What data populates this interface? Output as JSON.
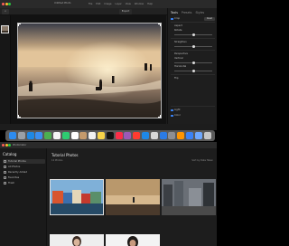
{
  "editor": {
    "title": "Untitled Photo",
    "menus": [
      "File",
      "Edit",
      "Image",
      "Layer",
      "View",
      "Window",
      "Help"
    ],
    "toolbar": {
      "back_label": "<",
      "export_label": "Export"
    },
    "panel": {
      "tabs": [
        "Tools",
        "Presets",
        "Styles"
      ],
      "active_tab": "Tools",
      "rows": [
        {
          "label": "Crop",
          "checked": true,
          "button": "Reset"
        },
        {
          "label": "Aspect",
          "checked": false,
          "button": ""
        },
        {
          "label": "Rotate",
          "checked": false,
          "button": ""
        },
        {
          "label": "Straighten",
          "checked": false,
          "button": ""
        },
        {
          "label": "Perspective",
          "checked": false,
          "button": ""
        },
        {
          "label": "Vertical",
          "checked": false,
          "button": ""
        },
        {
          "label": "Horizontal",
          "checked": false,
          "button": ""
        },
        {
          "label": "Flip",
          "checked": false,
          "button": ""
        },
        {
          "label": "Light",
          "checked": true,
          "button": ""
        },
        {
          "label": "Color",
          "checked": true,
          "button": ""
        }
      ]
    }
  },
  "dock": {
    "apps": [
      {
        "name": "finder",
        "color": "#2d8cf0"
      },
      {
        "name": "launchpad",
        "color": "#9aa0a6"
      },
      {
        "name": "safari",
        "color": "#1e88e5"
      },
      {
        "name": "mail",
        "color": "#3b8ef0"
      },
      {
        "name": "maps",
        "color": "#4caf50"
      },
      {
        "name": "photos",
        "color": "#f5f5f5"
      },
      {
        "name": "facetime",
        "color": "#2ecc71"
      },
      {
        "name": "calendar",
        "color": "#ffffff"
      },
      {
        "name": "contacts",
        "color": "#c49a6c"
      },
      {
        "name": "reminders",
        "color": "#f0f0f0"
      },
      {
        "name": "notes",
        "color": "#f7d34a"
      },
      {
        "name": "tv",
        "color": "#111111"
      },
      {
        "name": "music",
        "color": "#fa2d48"
      },
      {
        "name": "podcasts",
        "color": "#9b59b6"
      },
      {
        "name": "news",
        "color": "#ff3b30"
      },
      {
        "name": "app-store",
        "color": "#1e88e5"
      },
      {
        "name": "preview",
        "color": "#d7d7d7"
      },
      {
        "name": "pixelmator",
        "color": "#2c7be5"
      },
      {
        "name": "system-settings",
        "color": "#8e8e93"
      },
      {
        "name": "photomator",
        "color": "#ff9500"
      },
      {
        "name": "screen-sharing",
        "color": "#3a82f6"
      },
      {
        "name": "downloads",
        "color": "#6ea8ff"
      },
      {
        "name": "trash",
        "color": "#c7c7c7"
      }
    ]
  },
  "browser": {
    "window_title": "Photomator",
    "sidebar": {
      "title": "Catalog",
      "items": [
        {
          "label": "Tutorial Photos",
          "selected": true
        },
        {
          "label": "All Photos",
          "selected": false
        },
        {
          "label": "Recently Added",
          "selected": false
        },
        {
          "label": "Favorites",
          "selected": false
        },
        {
          "label": "Trash",
          "selected": false
        }
      ]
    },
    "main": {
      "title": "Tutorial Photos",
      "subtitle": "12 Photos",
      "sort_label": "Sort by Date Taken"
    }
  }
}
